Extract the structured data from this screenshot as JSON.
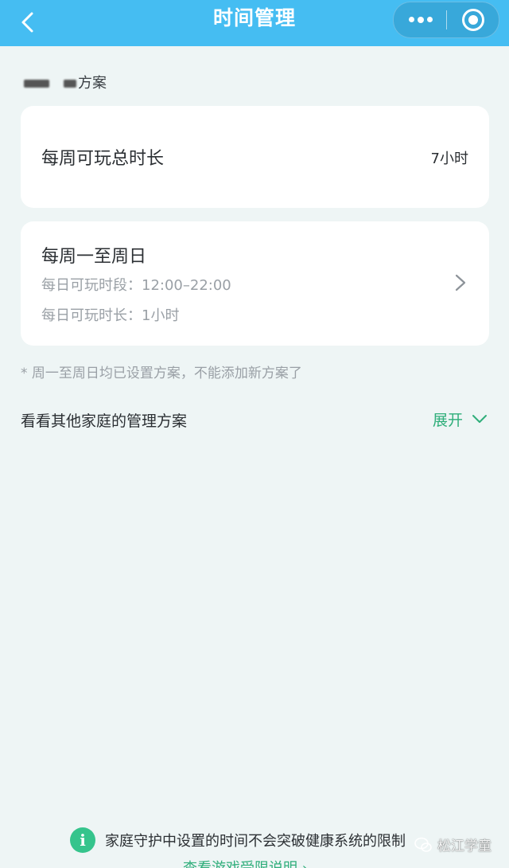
{
  "header": {
    "title": "时间管理",
    "back_icon": "chevron-left-icon",
    "more_icon": "more-dots-icon",
    "close_icon": "miniprogram-close-icon",
    "background_color": "#45bdf2"
  },
  "plan": {
    "label_suffix": "方案"
  },
  "weekly_total": {
    "label": "每周可玩总时长",
    "value": "7小时"
  },
  "schedule": {
    "title": "每周一至周日",
    "period": "每日可玩时段：12:00–22:00",
    "duration": "每日可玩时长：1小时"
  },
  "note": "* 周一至周日均已设置方案，不能添加新方案了",
  "others": {
    "label": "看看其他家庭的管理方案",
    "expand_label": "展开"
  },
  "bottom": {
    "notice": "家庭守护中设置的时间不会突破健康系统的限制",
    "link": "查看游戏受限说明 ›"
  },
  "watermark": {
    "text": "松江学童"
  },
  "colors": {
    "accent_green": "#2fae7a",
    "page_background": "#eef5f5"
  }
}
